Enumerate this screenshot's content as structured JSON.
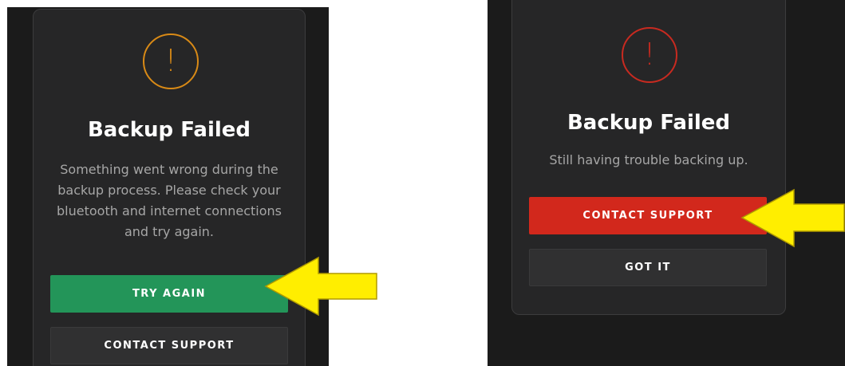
{
  "dialogs": [
    {
      "title": "Backup Failed",
      "message": "Something went wrong during the backup process. Please check your bluetooth and internet connections and try again.",
      "icon_glyph": "!",
      "icon": "warning-circle-icon",
      "icon_color": "#d98a16",
      "primary_button": "TRY AGAIN",
      "primary_color": "#239559",
      "secondary_button": "CONTACT SUPPORT"
    },
    {
      "title": "Backup Failed",
      "message": "Still having trouble backing up.",
      "icon_glyph": "!",
      "icon": "error-circle-icon",
      "icon_color": "#c82a20",
      "primary_button": "CONTACT SUPPORT",
      "primary_color": "#d2281c",
      "secondary_button": "GOT IT"
    }
  ],
  "colors": {
    "panel_background": "#1b1b1b",
    "card_background": "#262627",
    "secondary_button": "#303031",
    "arrow_fill": "#ffee00",
    "arrow_outline": "#b09a00"
  }
}
